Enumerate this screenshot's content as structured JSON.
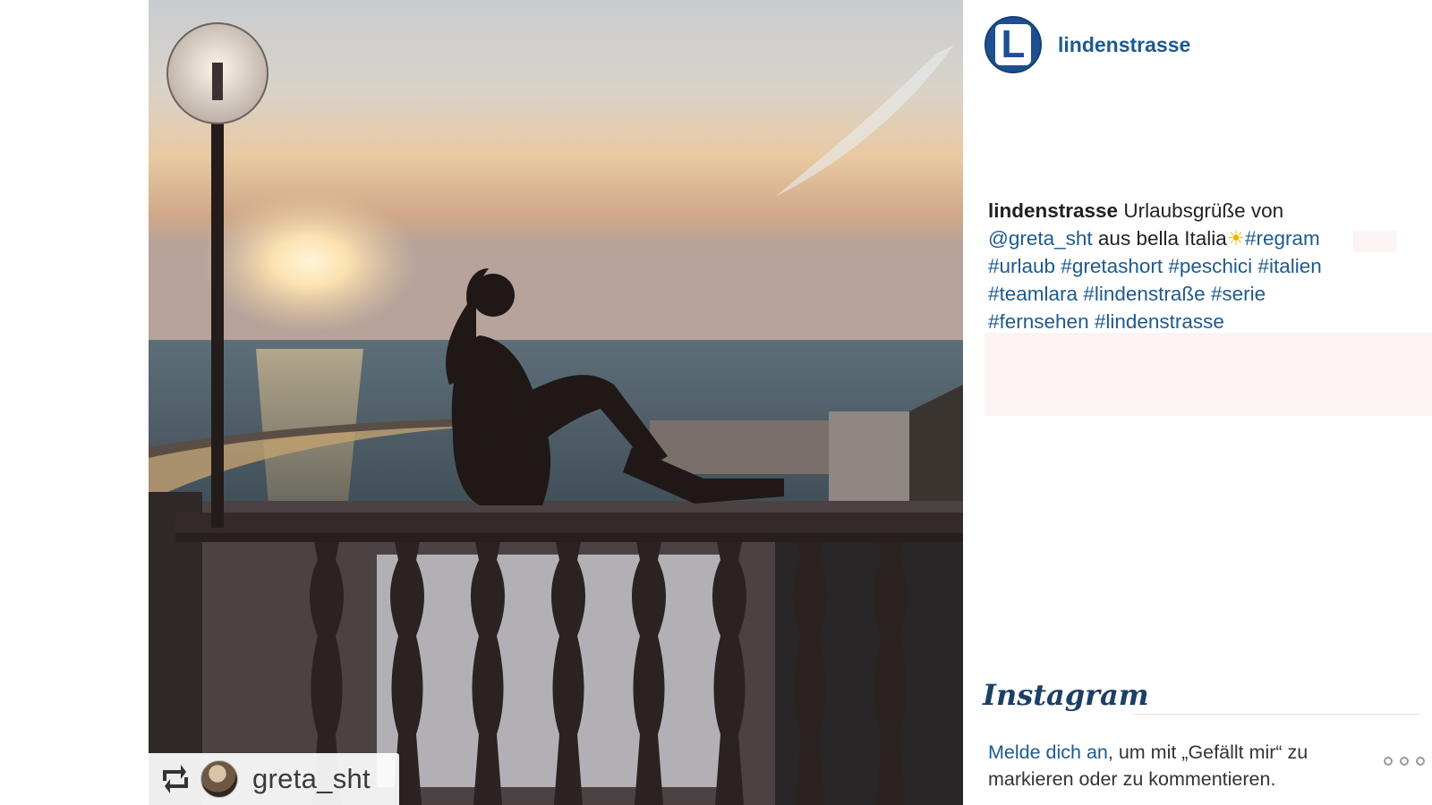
{
  "post": {
    "username": "lindenstrasse",
    "avatar_letter": "L",
    "image": {
      "description_icon": "regram-icon",
      "regram_user": "greta_sht"
    },
    "caption": {
      "user": "lindenstrasse",
      "text_1": "Urlaubsgrüße von",
      "mention": "@greta_sht",
      "text_2": "aus bella Italia",
      "sun": "☀",
      "tags_line1": "#regram",
      "tags_line2": "#urlaub #gretashort #peschici #italien",
      "tags_line3": "#teamlara #lindenstraße #serie",
      "tags_line4": "#fernsehen #lindenstrasse"
    }
  },
  "footer": {
    "brand": "Instagram",
    "login_link": "Melde dich an",
    "login_text": ", um mit „Gefällt mir“ zu markieren oder zu kommentieren."
  },
  "colors": {
    "link": "#1d5a8f",
    "brand_blue": "#1d4f91"
  }
}
